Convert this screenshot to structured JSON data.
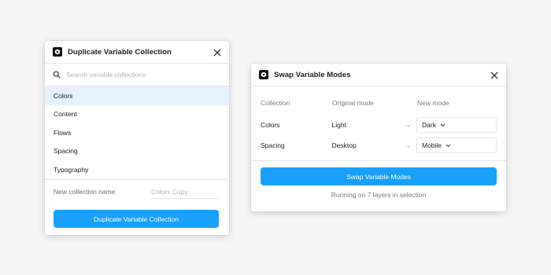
{
  "duplicate_panel": {
    "title": "Duplicate Variable Collection",
    "search_placeholder": "Search variable collections",
    "collections": [
      {
        "label": "Colors",
        "selected": true
      },
      {
        "label": "Content",
        "selected": false
      },
      {
        "label": "Flows",
        "selected": false
      },
      {
        "label": "Spacing",
        "selected": false
      },
      {
        "label": "Typography",
        "selected": false
      }
    ],
    "new_name_label": "New collection name",
    "new_name_placeholder": "Colors Copy",
    "button_label": "Duplicate Variable Collection"
  },
  "swap_panel": {
    "title": "Swap Variable Modes",
    "headers": {
      "collection": "Collection",
      "original_mode": "Original mode",
      "new_mode": "New mode"
    },
    "rows": [
      {
        "collection": "Colors",
        "original": "Light",
        "arrow": "→",
        "new_mode": "Dark"
      },
      {
        "collection": "Spacing",
        "original": "Desktop",
        "arrow": "→",
        "new_mode": "Mobile"
      }
    ],
    "button_label": "Swap Variable Modes",
    "status": "Running on 7 layers in selection"
  },
  "colors": {
    "accent": "#18a0fb",
    "selected_bg": "#e5f2fe",
    "background": "#f5f5f5"
  },
  "icons": [
    "plugin-icon",
    "close-icon",
    "search-icon",
    "chevron-down-icon"
  ]
}
